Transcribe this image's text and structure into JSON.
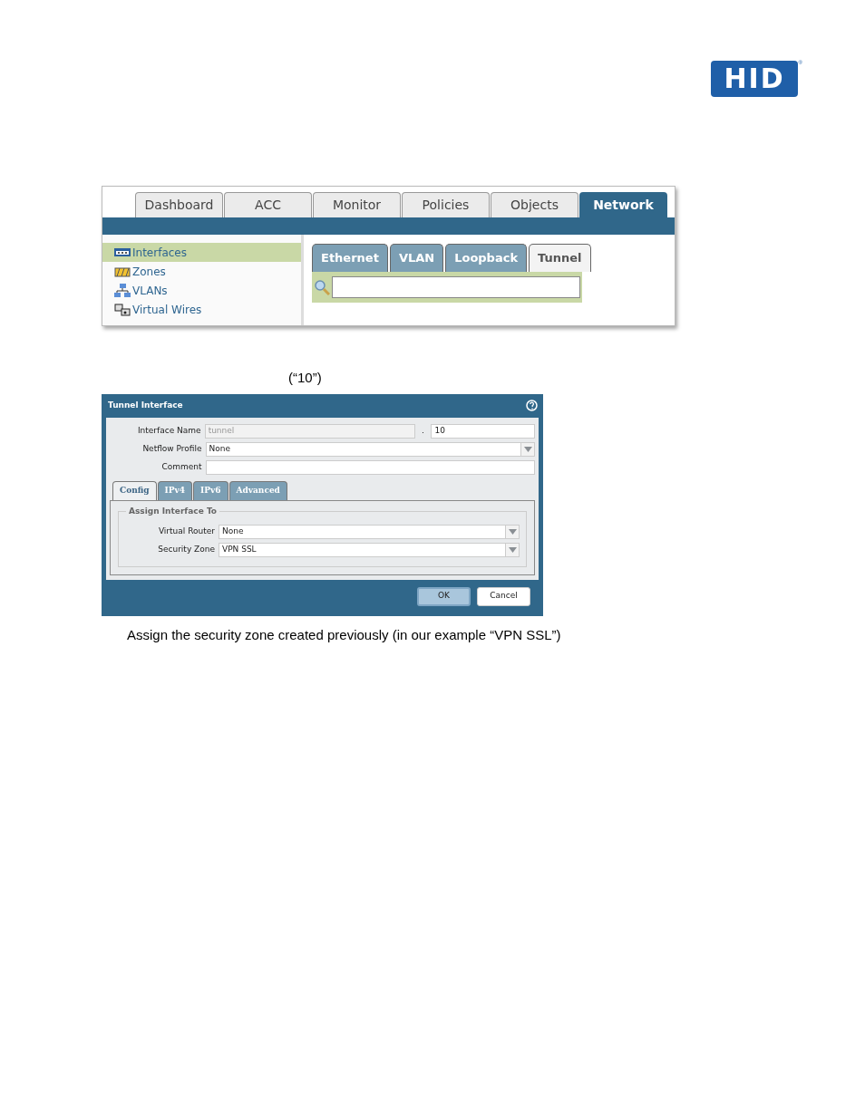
{
  "logo": {
    "text": "HID",
    "mark": "®"
  },
  "app": {
    "main_tabs": [
      {
        "label": "Dashboard",
        "selected": false
      },
      {
        "label": "ACC",
        "selected": false
      },
      {
        "label": "Monitor",
        "selected": false
      },
      {
        "label": "Policies",
        "selected": false
      },
      {
        "label": "Objects",
        "selected": false
      },
      {
        "label": "Network",
        "selected": true
      }
    ],
    "sidebar": {
      "items": [
        {
          "label": "Interfaces",
          "selected": true
        },
        {
          "label": "Zones",
          "selected": false
        },
        {
          "label": "VLANs",
          "selected": false
        },
        {
          "label": "Virtual Wires",
          "selected": false
        }
      ]
    },
    "sub_tabs": [
      {
        "label": "Ethernet",
        "selected": false
      },
      {
        "label": "VLAN",
        "selected": false
      },
      {
        "label": "Loopback",
        "selected": false
      },
      {
        "label": "Tunnel",
        "selected": true
      }
    ]
  },
  "note_1": "(“10”)",
  "dialog": {
    "title": "Tunnel Interface",
    "interface_name": {
      "label": "Interface Name",
      "value": "tunnel",
      "disabled": true,
      "separator": ".",
      "number": "10"
    },
    "netflow_profile": {
      "label": "Netflow Profile",
      "value": "None"
    },
    "comment": {
      "label": "Comment"
    },
    "tabs": [
      {
        "label": "Config",
        "selected": true
      },
      {
        "label": "IPv4",
        "selected": false
      },
      {
        "label": "IPv6",
        "selected": false
      },
      {
        "label": "Advanced",
        "selected": false
      }
    ],
    "group": {
      "title": "Assign Interface To",
      "fields": [
        {
          "label": "Virtual Router",
          "value": "None"
        },
        {
          "label": "Security Zone",
          "value": "VPN SSL"
        }
      ]
    },
    "buttons": [
      {
        "label": "OK",
        "kind": "primary"
      },
      {
        "label": "Cancel",
        "kind": "secondary"
      }
    ]
  },
  "note_2": "Assign the security zone created previously (in our example “VPN SSL”)"
}
